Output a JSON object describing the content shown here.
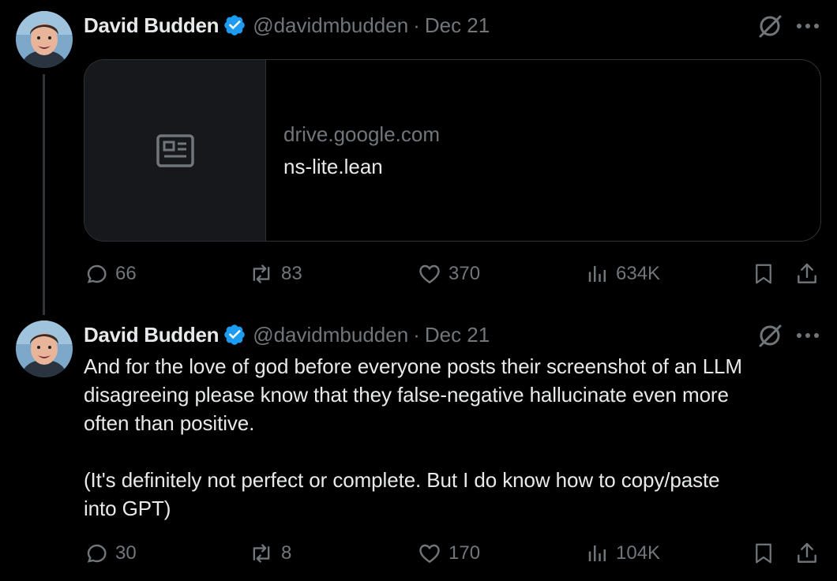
{
  "tweets": [
    {
      "author": {
        "name": "David Budden",
        "handle": "@davidmbudden",
        "dot": "·",
        "date": "Dec 21"
      },
      "card": {
        "domain": "drive.google.com",
        "title": "ns-lite.lean"
      },
      "stats": {
        "replies": "66",
        "retweets": "83",
        "likes": "370",
        "views": "634K"
      }
    },
    {
      "author": {
        "name": "David Budden",
        "handle": "@davidmbudden",
        "dot": "·",
        "date": "Dec 21"
      },
      "text_line1": "And for the love of god before everyone posts their screenshot of an LLM",
      "text_line2": "disagreeing please know that they false-negative hallucinate even more",
      "text_line3": "often than positive.",
      "text_line4": "(It's definitely not perfect or complete. But I do know how to copy/paste",
      "text_line5": "into GPT)",
      "stats": {
        "replies": "30",
        "retweets": "8",
        "likes": "170",
        "views": "104K"
      }
    }
  ],
  "colors": {
    "background": "#000000",
    "text": "#e7e9ea",
    "muted": "#71767b",
    "verified": "#1d9bf0",
    "border": "#2f3336"
  }
}
